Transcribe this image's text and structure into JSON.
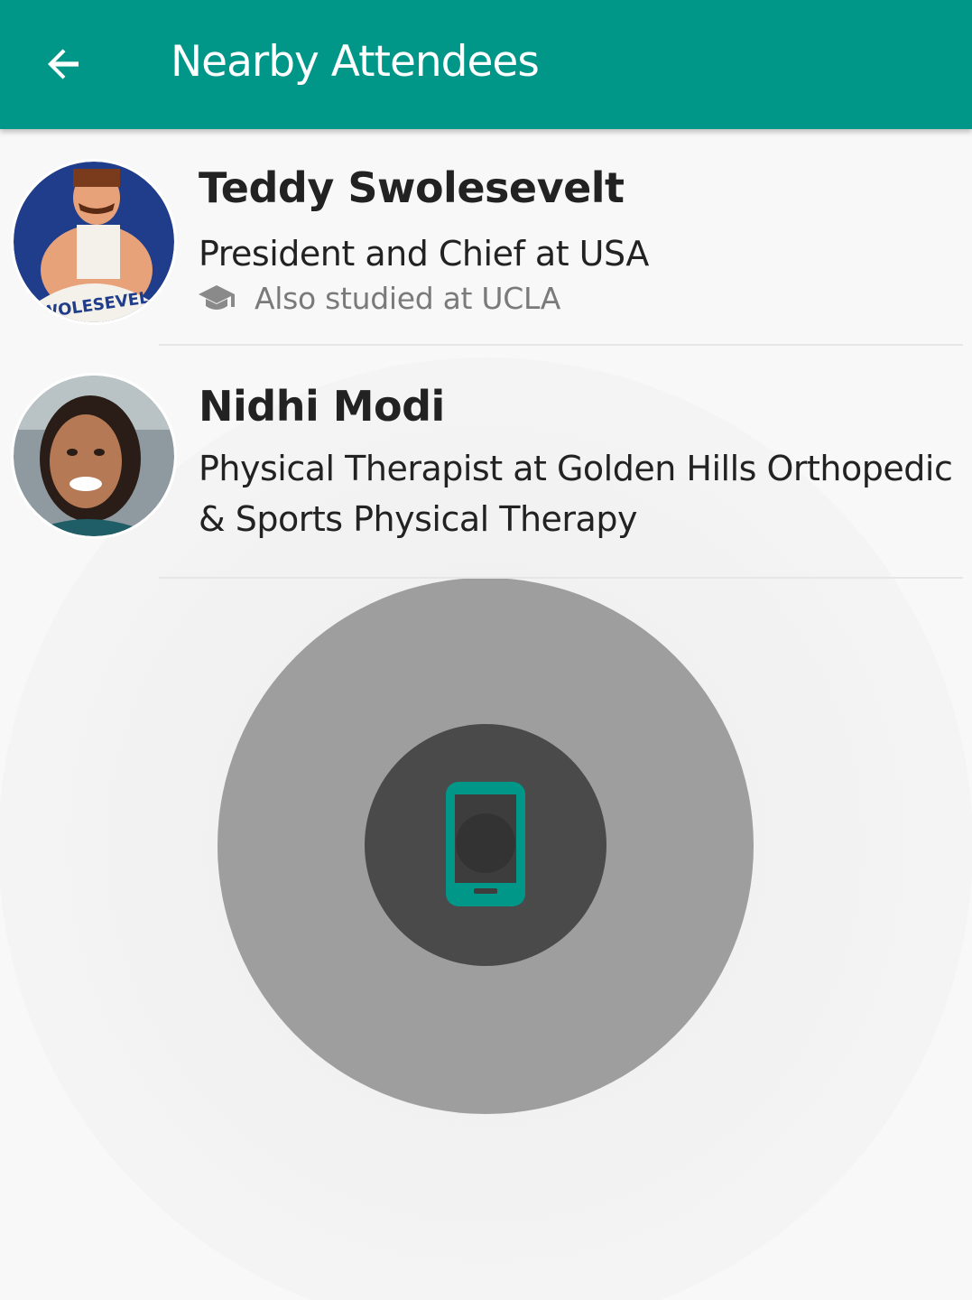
{
  "appbar": {
    "title": "Nearby Attendees",
    "back_icon": "arrow-back-icon",
    "color": "#009688"
  },
  "attendees": [
    {
      "name": "Teddy Swolesevelt",
      "title": "President and Chief at USA",
      "mutual_icon": "graduation-cap-icon",
      "mutual_text": "Also studied at UCLA",
      "avatar_text": "SWOLESEVELT"
    },
    {
      "name": "Nidhi Modi",
      "title": "Physical Therapist at Golden Hills Orthopedic & Sports Physical Therapy"
    }
  ],
  "radar": {
    "center_icon": "smartphone-icon",
    "outer_color": "#9e9e9e",
    "inner_color": "#4a4a4a",
    "icon_color": "#009688"
  }
}
